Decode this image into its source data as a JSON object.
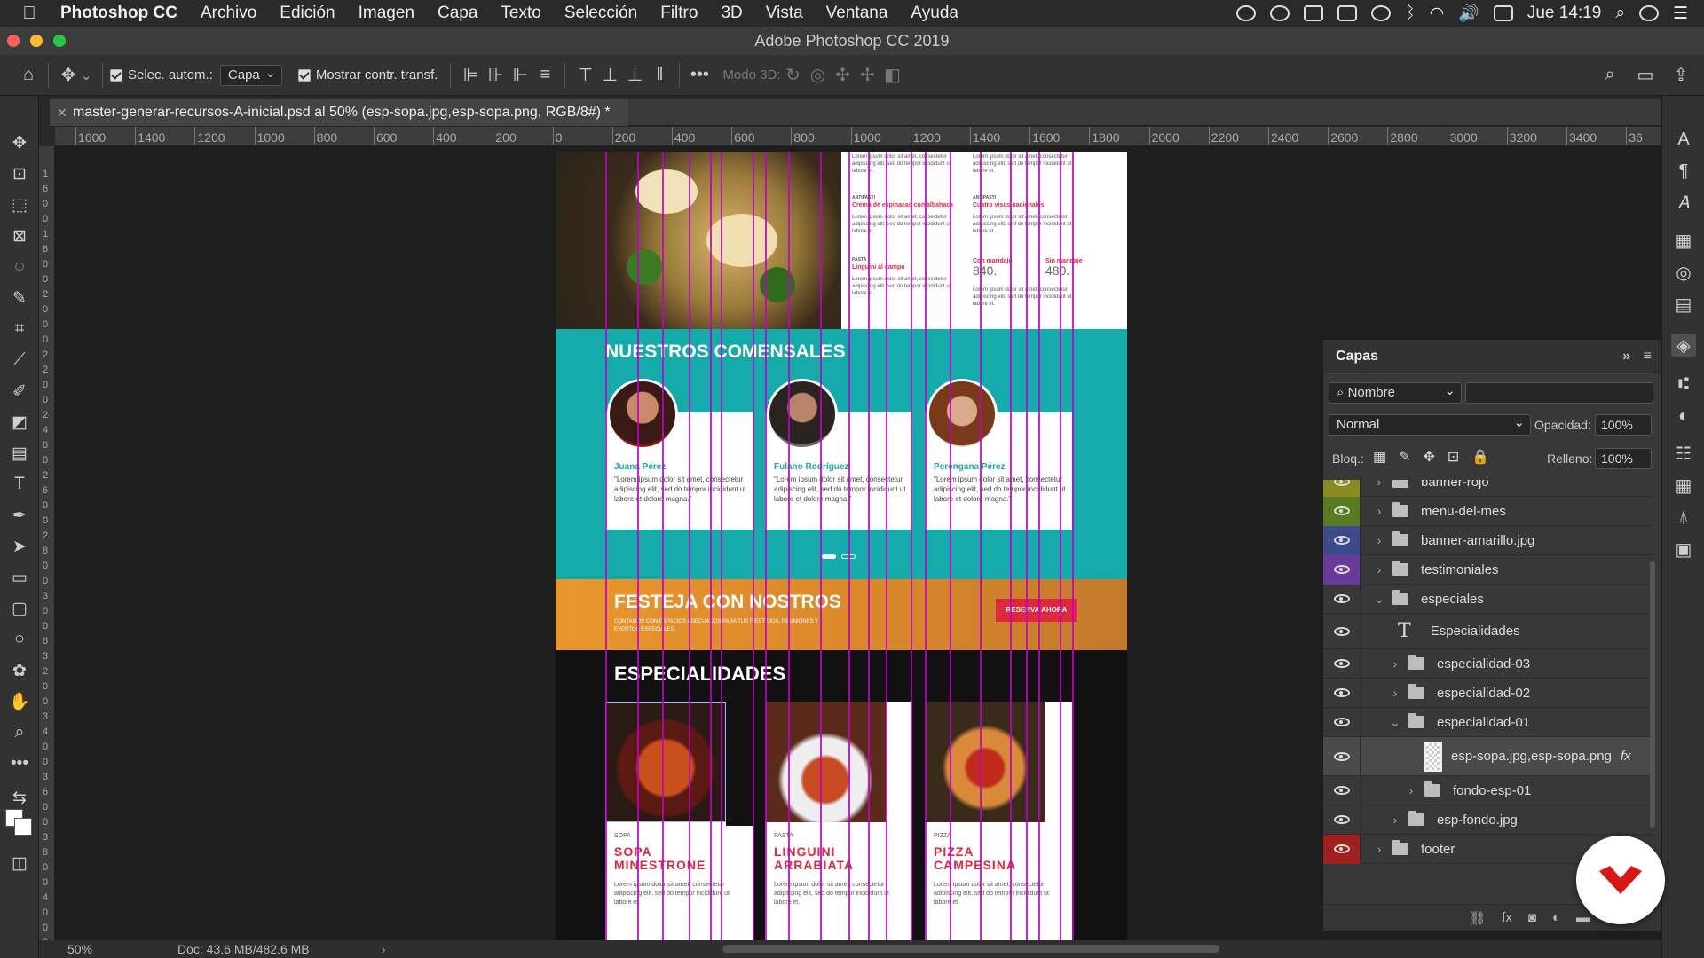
{
  "menubar": {
    "app": "Photoshop CC",
    "items": [
      "Archivo",
      "Edición",
      "Imagen",
      "Capa",
      "Texto",
      "Selección",
      "Filtro",
      "3D",
      "Vista",
      "Ventana",
      "Ayuda"
    ],
    "clock": "Jue 14:19"
  },
  "window": {
    "title": "Adobe Photoshop CC 2019"
  },
  "options": {
    "auto_select": "Selec. autom.:",
    "target": "Capa",
    "show_transform": "Mostrar contr. transf.",
    "mode3d": "Modo 3D:"
  },
  "document": {
    "tab": "master-generar-recursos-A-inicial.psd al 50% (esp-sopa.jpg,esp-sopa.png, RGB/8#) *"
  },
  "ruler": {
    "x": [
      "1600",
      "1400",
      "1200",
      "1000",
      "800",
      "600",
      "400",
      "200",
      "0",
      "200",
      "400",
      "600",
      "800",
      "1000",
      "1200",
      "1400",
      "1600",
      "1800",
      "2000",
      "2200",
      "2400",
      "2600",
      "2800",
      "3000",
      "3200",
      "3400",
      "36"
    ],
    "y": [
      "1",
      "6",
      "0",
      "0",
      "1",
      "8",
      "0",
      "0",
      "2",
      "0",
      "0",
      "0",
      "2",
      "2",
      "0",
      "0",
      "2",
      "4",
      "0",
      "0",
      "2",
      "6",
      "0",
      "0",
      "2",
      "8",
      "0",
      "0",
      "3",
      "0",
      "0",
      "0",
      "3",
      "2",
      "0",
      "0",
      "3",
      "4",
      "0",
      "0",
      "3",
      "6",
      "0",
      "0",
      "3",
      "8",
      "0",
      "0",
      "4",
      "0",
      "0",
      "0"
    ]
  },
  "design": {
    "menu_items": [
      "Crema de espinacas con albahaca",
      "Cuatro visos nacionales",
      "Linguini al campo",
      "Con maridaje",
      "Sin maridaje"
    ],
    "prices": [
      "840.",
      "480."
    ],
    "testimonials_title": "NUESTROS COMENSALES",
    "people": [
      "Juana Pérez",
      "Fulano Rodríguez",
      "Perengana Pérez"
    ],
    "lorem": "\"Lorem ipsum dolor sit amet, consectetur adipiscing elit, sed do tempor incididunt ut labore et dolore magna.\"",
    "lorem_short": "Lorem ipsum dolor sit amet, consectetur adipiscing elit, sed do tempor incididunt ut labore et.",
    "party_title": "FESTEJA CON NOSTROS",
    "party_sub": "CONTAMOS CON ESPACIOS ADECUADOS PARA TUS FIESTEJOS, REUNIONES Y EVENTOS ESPECIALES.",
    "reserve": "RESERVA AHORA",
    "spec_title": "ESPECIALIDADES",
    "spec_cards": [
      {
        "cat": "SOPA",
        "name": "SOPA MINESTRONE"
      },
      {
        "cat": "PASTA",
        "name": "LINGUINI ARRABIATA"
      },
      {
        "cat": "PIZZA",
        "name": "PIZZA CAMPESINA"
      }
    ],
    "small_labels": [
      "ANTIPASTI",
      "ANTIPASTI",
      "PASTA"
    ]
  },
  "layers": {
    "title": "Capas",
    "filter": "Nombre",
    "blend": "Normal",
    "opacity_label": "Opacidad:",
    "opacity": "100%",
    "lock_label": "Bloq.:",
    "fill_label": "Relleno:",
    "fill": "100%",
    "rows": [
      {
        "name": "banner-rojo",
        "color": "#8a8a1f"
      },
      {
        "name": "menu-del-mes",
        "color": "#5a7a1f"
      },
      {
        "name": "banner-amarillo.jpg",
        "color": "#3a4a8a"
      },
      {
        "name": "testimoniales",
        "color": "#6a3a9a"
      },
      {
        "name": "especiales",
        "color": ""
      },
      {
        "name": "Especialidades",
        "color": ""
      },
      {
        "name": "especialidad-03",
        "color": ""
      },
      {
        "name": "especialidad-02",
        "color": ""
      },
      {
        "name": "especialidad-01",
        "color": ""
      },
      {
        "name": "esp-sopa.jpg,esp-sopa.png",
        "color": ""
      },
      {
        "name": "fondo-esp-01",
        "color": ""
      },
      {
        "name": "esp-fondo.jpg",
        "color": ""
      },
      {
        "name": "footer",
        "color": "#a01f1f"
      }
    ]
  },
  "status": {
    "zoom": "50%",
    "doc": "Doc: 43.6 MB/482.6 MB"
  },
  "colors": {
    "teal": "#15abab",
    "orange": "#e0912c",
    "red": "#e0283c",
    "dark": "#111111",
    "guide": "#c000c8"
  }
}
